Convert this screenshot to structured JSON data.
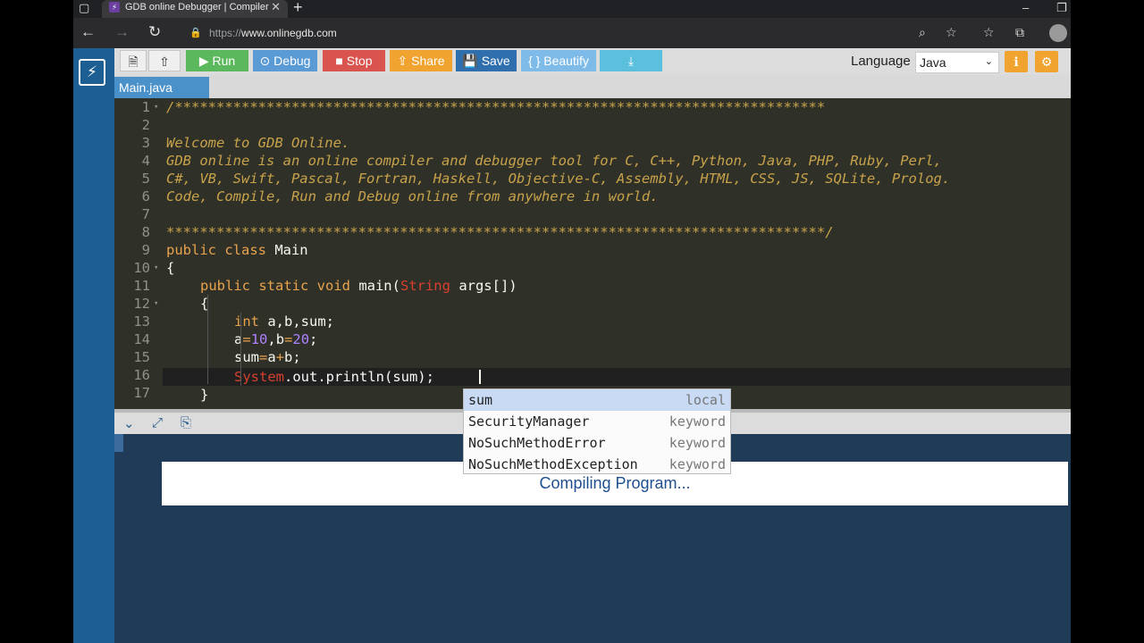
{
  "browser": {
    "tab_title": "GDB online Debugger | Compiler",
    "tab_favicon": "⚡",
    "url_scheme": "https://",
    "url_host": "www.onlinegdb.com"
  },
  "toolbar": {
    "run_label": "Run",
    "debug_label": "Debug",
    "stop_label": "Stop",
    "share_label": "Share",
    "save_label": "Save",
    "beautify_label": "{ } Beautify",
    "language_label": "Language",
    "language_value": "Java",
    "colors": {
      "run": "#5cb85c",
      "debug": "#5b9bd5",
      "stop": "#d9534f",
      "share": "#f0a32e",
      "save": "#2f6fae",
      "beautify": "#7fbbe8",
      "download": "#5bc0de"
    }
  },
  "file_tab": "Main.java",
  "editor": {
    "line_numbers": [
      "1",
      "2",
      "3",
      "4",
      "5",
      "6",
      "7",
      "8",
      "9",
      "10",
      "11",
      "12",
      "13",
      "14",
      "15",
      "16",
      "17"
    ],
    "comment_top": "/******************************************************************************",
    "comment_welcome": "Welcome to GDB Online.",
    "comment_line4": "GDB online is an online compiler and debugger tool for C, C++, Python, Java, PHP, Ruby, Perl,",
    "comment_line5": "C#, VB, Swift, Pascal, Fortran, Haskell, Objective-C, Assembly, HTML, CSS, JS, SQLite, Prolog.",
    "comment_line6": "Code, Compile, Run and Debug online from anywhere in world.",
    "comment_bottom": "*******************************************************************************/",
    "line9_kw": "public class",
    "line9_name": " Main",
    "line10": "{",
    "line11_kw": "public static void",
    "line11_main": " main(",
    "line11_type": "String",
    "line11_rest": " args[])",
    "line12": "{",
    "line13_kw": "int",
    "line13_rest": " a,b,sum;",
    "line14_a": "a",
    "line14_eq1": "=",
    "line14_n1": "10",
    "line14_mid": ",b",
    "line14_eq2": "=",
    "line14_n2": "20",
    "line14_end": ";",
    "line15_a": "sum",
    "line15_eq": "=",
    "line15_b": "a",
    "line15_plus": "+",
    "line15_c": "b;",
    "line16_sys": "System",
    "line16_rest": ".out.println(sum);",
    "line17": "}"
  },
  "autocomplete": [
    {
      "name": "sum",
      "meta": "local"
    },
    {
      "name": "SecurityManager",
      "meta": "keyword"
    },
    {
      "name": "NoSuchMethodError",
      "meta": "keyword"
    },
    {
      "name": "NoSuchMethodException",
      "meta": "keyword"
    }
  ],
  "output": {
    "status": "Compiling Program..."
  },
  "icons": {
    "new_file": "file-icon",
    "upload": "cloud-upload-icon",
    "run": "play-icon",
    "debug": "debug-icon",
    "stop": "stop-icon",
    "share": "share-icon",
    "save": "save-icon",
    "download": "download-icon",
    "info": "info-icon",
    "settings": "gear-icon"
  }
}
